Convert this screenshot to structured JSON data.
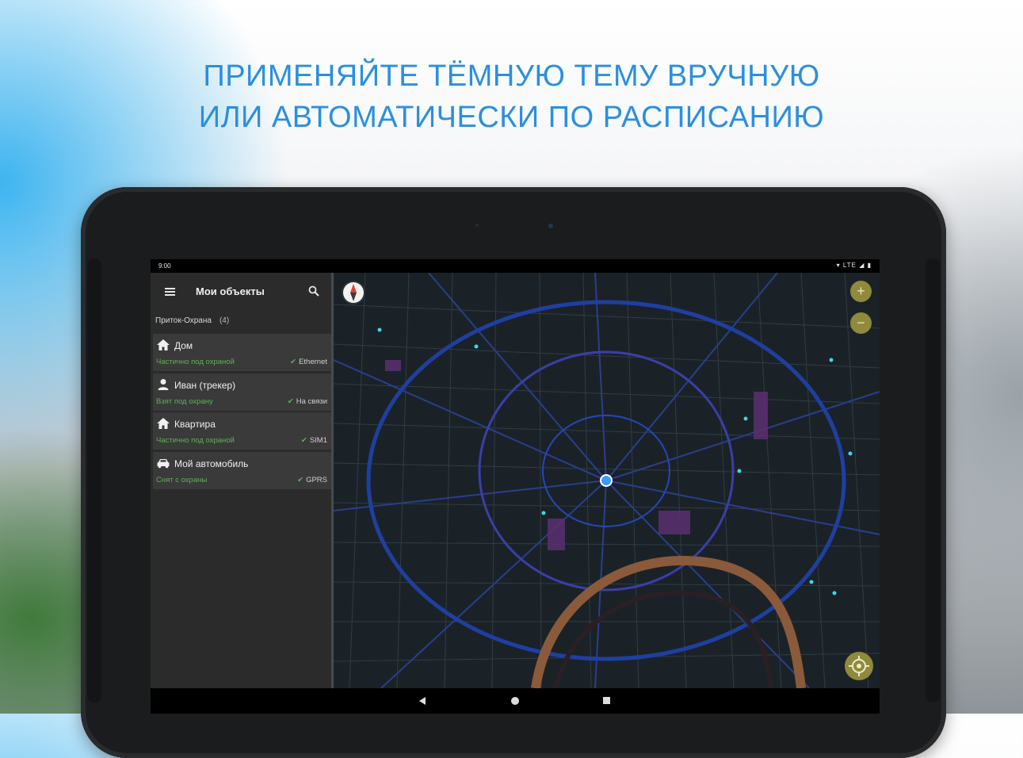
{
  "headline": {
    "line1": "ПРИМЕНЯЙТЕ ТЁМНУЮ ТЕМУ ВРУЧНУЮ",
    "line2": "ИЛИ АВТОМАТИЧЕСКИ ПО РАСПИСАНИЮ",
    "color": "#2a8fe0"
  },
  "statusbar": {
    "time": "9:00",
    "icons_text": "▾ LTE ◢ ▮"
  },
  "toolbar": {
    "title": "Мои объекты",
    "menu_icon": "menu-icon",
    "search_icon": "search-icon"
  },
  "group": {
    "name": "Приток-Охрана",
    "count": "(4)"
  },
  "items": [
    {
      "icon": "home-icon",
      "name": "Дом",
      "status": "Частично под охраной",
      "connection": "Ethernet"
    },
    {
      "icon": "person-icon",
      "name": "Иван (трекер)",
      "status": "Взят под охрану",
      "connection": "На связи"
    },
    {
      "icon": "home-icon",
      "name": "Квартира",
      "status": "Частично под охраной",
      "connection": "SIM1"
    },
    {
      "icon": "car-icon",
      "name": "Мой автомобиль",
      "status": "Снят с охраны",
      "connection": "GPRS"
    }
  ],
  "map": {
    "zoom_in": "+",
    "zoom_out": "−",
    "colors": {
      "background": "#1a2228",
      "main_road": "#1f3fa0",
      "ring_road": "#8a5a3a",
      "water": "#25313a",
      "accent": "#8f8a3c",
      "location": "#3a9bff"
    }
  },
  "status_color": "#5fb056"
}
